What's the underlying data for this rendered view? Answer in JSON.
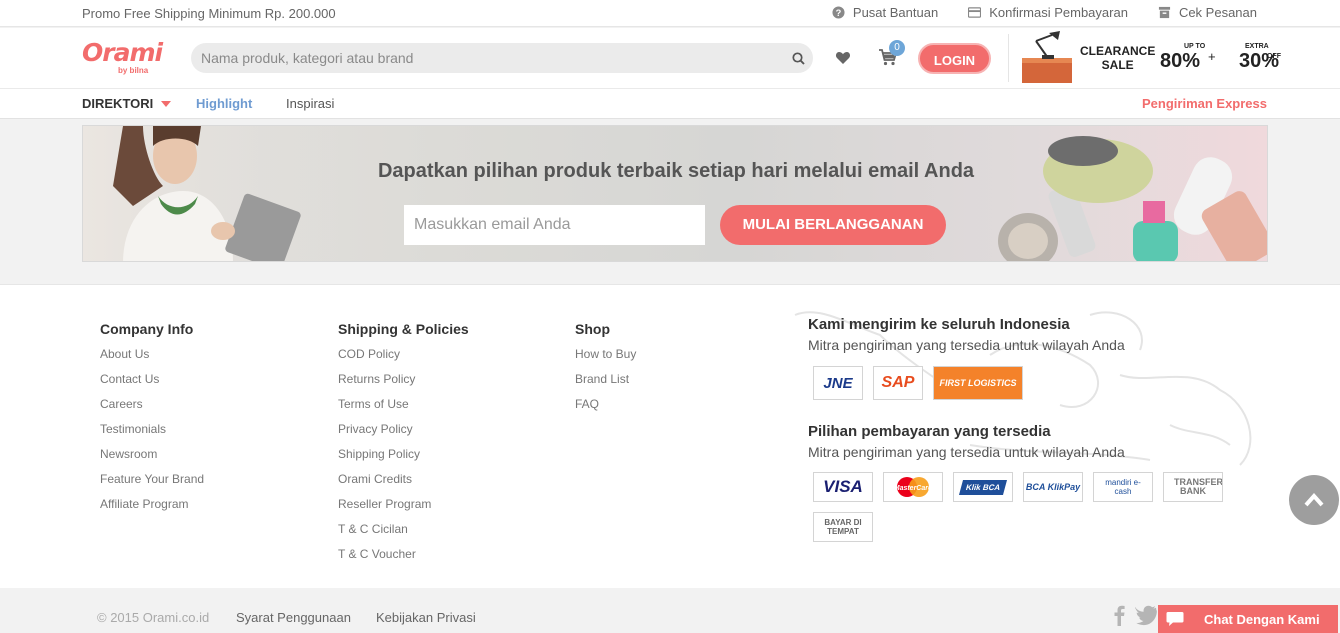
{
  "topbar": {
    "promo": "Promo Free Shipping Minimum Rp. 200.000",
    "links": [
      "Pusat Bantuan",
      "Konfirmasi Pembayaran",
      "Cek Pesanan"
    ]
  },
  "header": {
    "logo": "Orami",
    "logo_by": "by bilna",
    "search_placeholder": "Nama produk, kategori atau brand",
    "cart_count": "0",
    "login": "LOGIN",
    "clearance": {
      "line1": "CLEARANCE",
      "line2": "SALE",
      "upto": "UP TO",
      "percent1": "80%",
      "plus": "+",
      "extra": "EXTRA",
      "percent2": "30%",
      "off": "OFF"
    }
  },
  "nav": {
    "direktori": "DIREKTORI",
    "highlight": "Highlight",
    "inspirasi": "Inspirasi",
    "express": "Pengiriman Express"
  },
  "banner": {
    "title": "Dapatkan pilihan produk terbaik setiap hari melalui email Anda",
    "email_placeholder": "Masukkan email Anda",
    "subscribe": "MULAI BERLANGGANAN"
  },
  "footer": {
    "company": {
      "title": "Company Info",
      "links": [
        "About Us",
        "Contact Us",
        "Careers",
        "Testimonials",
        "Newsroom",
        "Feature Your Brand",
        "Affiliate Program"
      ]
    },
    "shipping": {
      "title": "Shipping & Policies",
      "links": [
        "COD Policy",
        "Returns Policy",
        "Terms of Use",
        "Privacy Policy",
        "Shipping Policy",
        "Orami Credits",
        "Reseller Program",
        "T & C Cicilan",
        "T & C Voucher"
      ]
    },
    "shop": {
      "title": "Shop",
      "links": [
        "How to Buy",
        "Brand List",
        "FAQ"
      ]
    },
    "ship_title": "Kami mengirim ke seluruh Indonesia",
    "ship_sub": "Mitra pengiriman yang tersedia untuk wilayah Anda",
    "couriers": [
      "JNE",
      "SAP",
      "FIRST LOGISTICS"
    ],
    "pay_title": "Pilihan pembayaran yang tersedia",
    "pay_sub": "Mitra pengiriman yang tersedia untuk wilayah Anda",
    "payments": [
      "VISA",
      "MasterCard",
      "Klik BCA",
      "BCA KlikPay",
      "mandiri e-cash",
      "TRANSFER BANK",
      "BAYAR DI TEMPAT"
    ]
  },
  "bottom": {
    "copyright": "© 2015 Orami.co.id",
    "terms": "Syarat Penggunaan",
    "privacy": "Kebijakan Privasi",
    "chat": "Chat Dengan Kami"
  },
  "colors": {
    "accent": "#f26c6c",
    "highlight": "#6f9bd1"
  }
}
